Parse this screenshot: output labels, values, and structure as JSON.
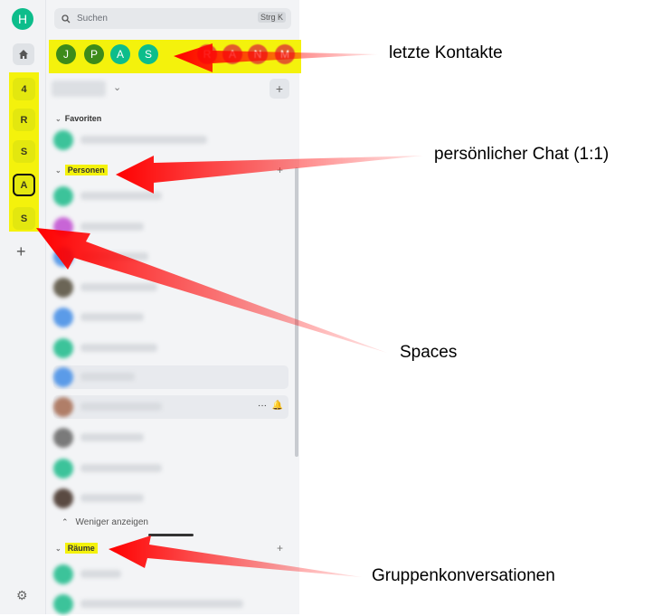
{
  "spacebar": {
    "user_initial": "H",
    "spaces": [
      "4",
      "R",
      "S",
      "A",
      "S"
    ],
    "add": "+",
    "settings_icon": "gear-icon"
  },
  "search": {
    "placeholder": "Suchen",
    "shortcut": "Strg K"
  },
  "recent_contacts": [
    "J",
    "P",
    "A",
    "S",
    "R",
    "A",
    "N",
    "M"
  ],
  "sections": {
    "favorites": "Favoriten",
    "people": "Personen",
    "rooms": "Räume",
    "show_less": "Weniger anzeigen"
  },
  "annotations": {
    "recent": "letzte Kontakte",
    "personal_chat": "persönlicher Chat (1:1)",
    "spaces": "Spaces",
    "groups": "Gruppenkonversationen"
  },
  "colors": {
    "accent": "#0dbd8b",
    "highlight": "#f4f20c",
    "arrow": "#ff0000"
  }
}
